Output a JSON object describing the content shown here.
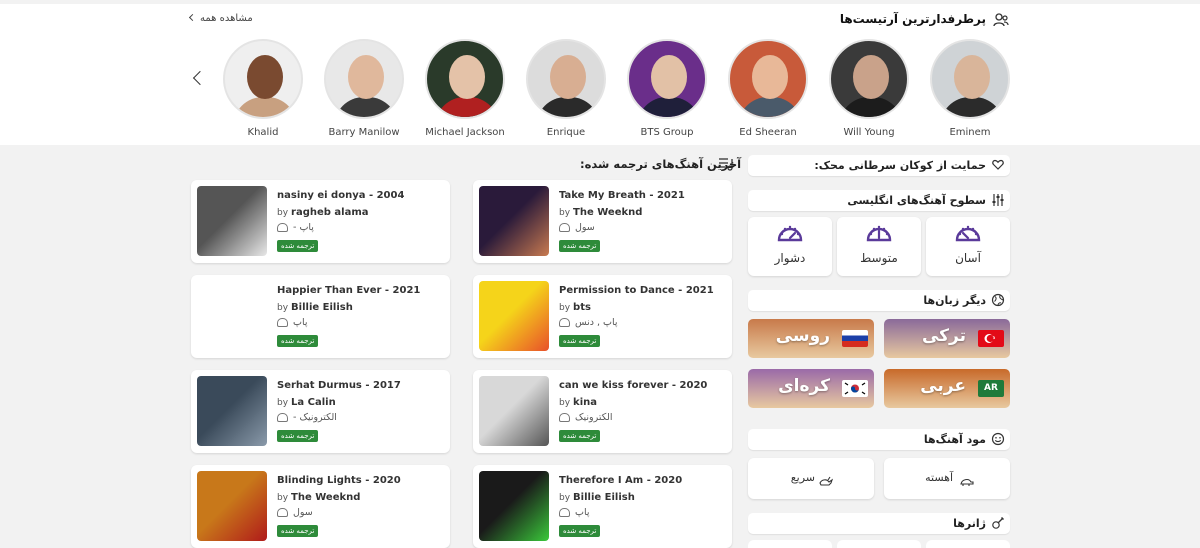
{
  "top_artists": {
    "title": "پرطرفدارترین آرتیست‌ها",
    "see_all": "مشاهده همه",
    "icon": "user-group-icon",
    "artists": [
      {
        "name": "Eminem",
        "skin": "#d9b59a",
        "cloth": "#2b2b2b",
        "bg": "#cfd3d6"
      },
      {
        "name": "Will Young",
        "skin": "#c9a28a",
        "cloth": "#1c1c1c",
        "bg": "#3a3a3a"
      },
      {
        "name": "Ed Sheeran",
        "skin": "#e8b898",
        "cloth": "#4a5a6a",
        "bg": "#c85a3a"
      },
      {
        "name": "BTS Group",
        "skin": "#e2c1a6",
        "cloth": "#1f1f3a",
        "bg": "#6a2e8a"
      },
      {
        "name": "Enrique",
        "skin": "#d8ae92",
        "cloth": "#2a2a2a",
        "bg": "#dcdcdc"
      },
      {
        "name": "Michael Jackson",
        "skin": "#e4c2a8",
        "cloth": "#b02020",
        "bg": "#2a3a2a"
      },
      {
        "name": "Barry Manilow",
        "skin": "#e0b89c",
        "cloth": "#3a3a3a",
        "bg": "#e8e8e8"
      },
      {
        "name": "Khalid",
        "skin": "#7a4a30",
        "cloth": "#c8a080",
        "bg": "#efefef"
      }
    ]
  },
  "latest": {
    "title": "آخرین آهنگ‌های ترجمه شده:",
    "icon": "music-list-icon",
    "by_label": "by",
    "badge": "ترجمه شده",
    "songs": [
      {
        "title": "nasiny ei donya - 2004",
        "artist": "ragheb alama",
        "genre": "پاپ  -",
        "cover": "#555555",
        "cover2": "#e8e8e8"
      },
      {
        "title": "Take My Breath - 2021",
        "artist": "The Weeknd",
        "genre": "سول",
        "cover": "#2a1a3a",
        "cover2": "#c87a50"
      },
      {
        "title": "Happier Than Ever - 2021",
        "artist": "Billie Eilish",
        "genre": "پاپ",
        "cover": "#ffffff",
        "cover2": "#ffffff"
      },
      {
        "title": "Permission to Dance - 2021",
        "artist": "bts",
        "genre": "پاپ , دنس",
        "cover": "#f5d41a",
        "cover2": "#e8502a"
      },
      {
        "title": "Serhat Durmus - 2017",
        "artist": "La Calin",
        "genre": "الکترونیک  -",
        "cover": "#3a4a5a",
        "cover2": "#8a9aaa"
      },
      {
        "title": "can we kiss forever - 2020",
        "artist": "kina",
        "genre": "الکترونیک",
        "cover": "#d8d8d8",
        "cover2": "#555555"
      },
      {
        "title": "Blinding Lights - 2020",
        "artist": "The Weeknd",
        "genre": "سول",
        "cover": "#c8781a",
        "cover2": "#b01a1a"
      },
      {
        "title": "Therefore I Am - 2020",
        "artist": "Billie Eilish",
        "genre": "پاپ",
        "cover": "#1a1a1a",
        "cover2": "#3ac83a"
      }
    ]
  },
  "sidebar": {
    "charity": {
      "label": "حمایت از کوکان سرطانی محک:",
      "icon": "heart-hand-icon"
    },
    "levels": {
      "title": "سطوح آهنگ‌های انگلیسی",
      "icon": "sliders-icon",
      "items": [
        {
          "label": "آسان",
          "icon": "gauge-easy-icon"
        },
        {
          "label": "متوسط",
          "icon": "gauge-medium-icon"
        },
        {
          "label": "دشوار",
          "icon": "gauge-hard-icon"
        }
      ],
      "accent": "#5a3a9a"
    },
    "languages": {
      "title": "دیگر زبان‌ها",
      "icon": "globe-icon",
      "items": [
        {
          "label": "ترکی",
          "bg": "#8a6a9a",
          "flag": "turkey-flag-icon"
        },
        {
          "label": "روسی",
          "bg": "#c87a4a",
          "flag": "russia-flag-icon"
        },
        {
          "label": "عربی",
          "bg": "#c86a2a",
          "flag": "arabic-flag-icon",
          "flag_text": "AR"
        },
        {
          "label": "کره‌ای",
          "bg": "#9a6aa8",
          "flag": "korea-flag-icon"
        }
      ]
    },
    "moods": {
      "title": "مود آهنگ‌ها",
      "icon": "smile-icon",
      "items": [
        {
          "label": "آهسته",
          "icon": "turtle-icon"
        },
        {
          "label": "سریع",
          "icon": "rabbit-icon"
        }
      ]
    },
    "genres": {
      "title": "ژانرها",
      "icon": "guitar-icon"
    }
  }
}
